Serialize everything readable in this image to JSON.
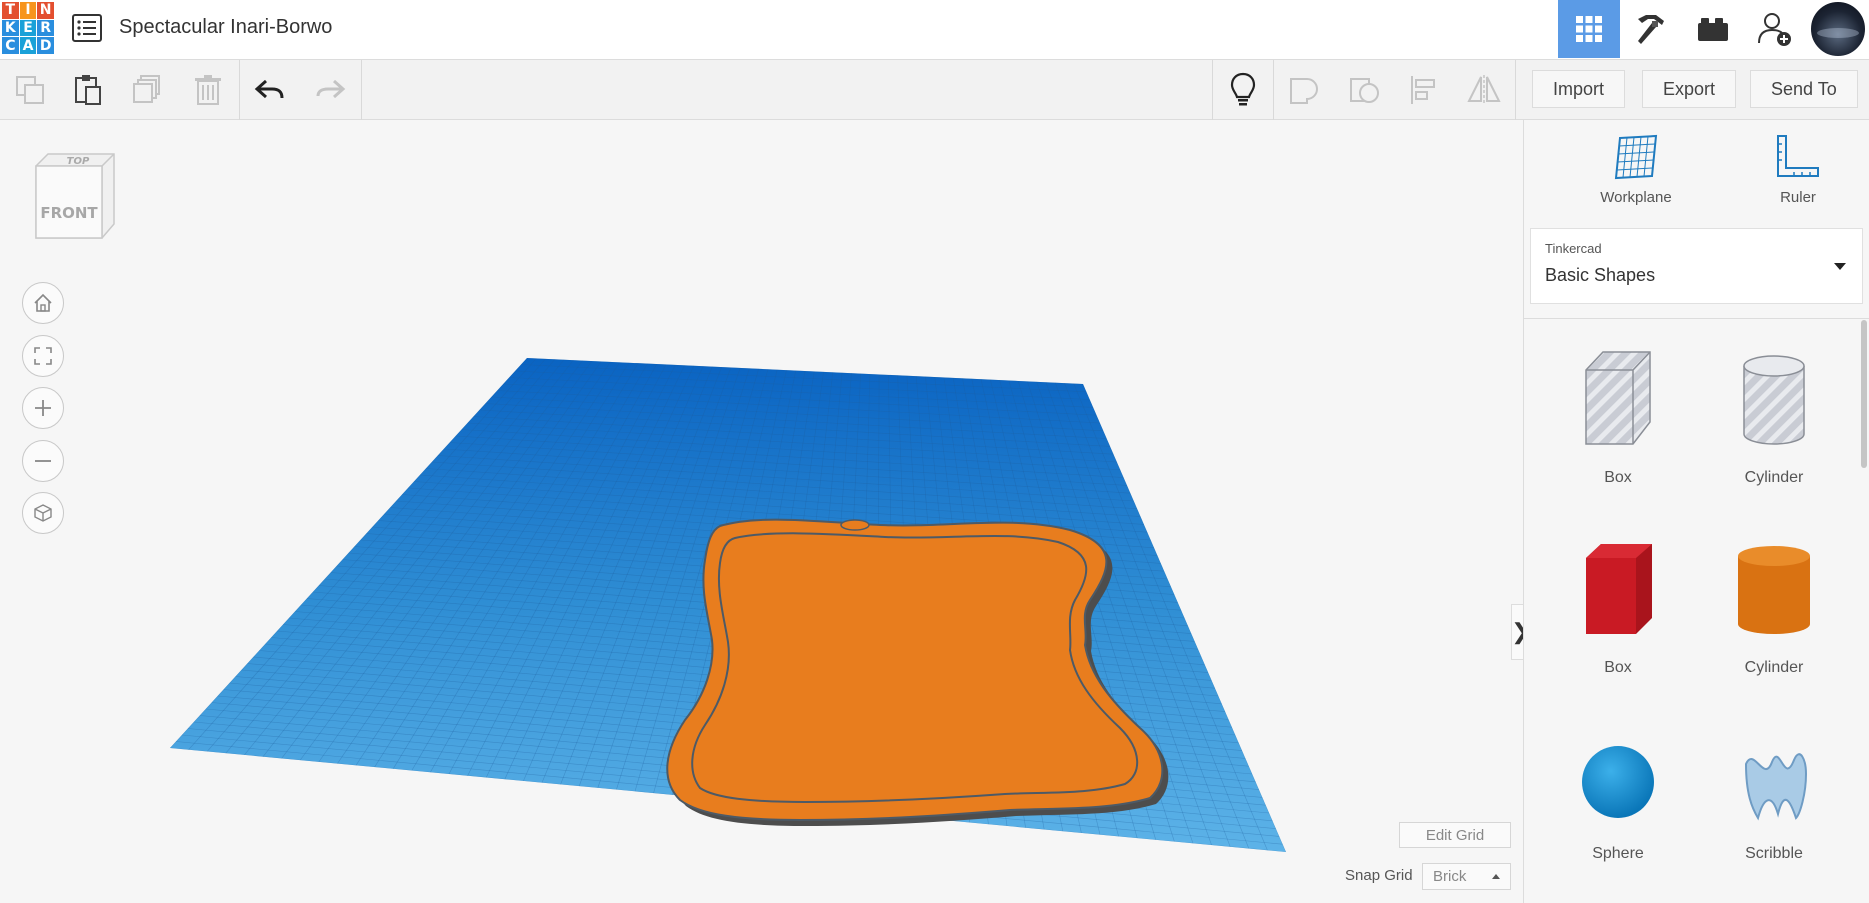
{
  "header": {
    "logo_letters": [
      "T",
      "I",
      "N",
      "K",
      "E",
      "R",
      "C",
      "A",
      "D"
    ],
    "logo_colors": [
      "#e34f2f",
      "#f7941d",
      "#e34f2f",
      "#2a8ede",
      "#1aa1d8",
      "#2a8ede",
      "#2a8ede",
      "#1aa1d8",
      "#2a8ede"
    ],
    "title": "Spectacular Inari-Borwo",
    "buttons": [
      {
        "name": "3d-design-view",
        "icon": "grid-icon",
        "active": true
      },
      {
        "name": "minecraft-view",
        "icon": "pickaxe-icon",
        "active": false
      },
      {
        "name": "lego-view",
        "icon": "brick-icon",
        "active": false
      },
      {
        "name": "invite-user",
        "icon": "add-user-icon",
        "active": false
      }
    ],
    "active_color": "#5b9be6"
  },
  "toolbar": {
    "left_tools": [
      "copy-icon",
      "paste-icon",
      "duplicate-icon",
      "delete-icon",
      "undo-icon",
      "redo-icon"
    ],
    "right_tools": [
      "lightbulb-icon",
      "group-icon",
      "ungroup-icon",
      "align-icon",
      "mirror-icon"
    ],
    "import_label": "Import",
    "export_label": "Export",
    "send_to_label": "Send To"
  },
  "viewport": {
    "viewcube_top": "TOP",
    "viewcube_front": "FRONT",
    "nav_buttons": [
      "home-icon",
      "fit-view-icon",
      "zoom-in-icon",
      "zoom-out-icon",
      "perspective-icon"
    ],
    "edit_grid_label": "Edit Grid",
    "snap_grid_label": "Snap Grid",
    "snap_grid_value": "Brick",
    "collapse_glyph": "❯",
    "workplane_color": "#2f8ed4",
    "object_color": "#e87d1e"
  },
  "panel": {
    "workplane_label": "Workplane",
    "ruler_label": "Ruler",
    "library_source": "Tinkercad",
    "library_name": "Basic Shapes",
    "shapes": [
      {
        "label": "Box",
        "kind": "box-hole"
      },
      {
        "label": "Cylinder",
        "kind": "cylinder-hole"
      },
      {
        "label": "Box",
        "kind": "box-red"
      },
      {
        "label": "Cylinder",
        "kind": "cylinder-orange"
      },
      {
        "label": "Sphere",
        "kind": "sphere-blue"
      },
      {
        "label": "Scribble",
        "kind": "scribble"
      }
    ]
  }
}
